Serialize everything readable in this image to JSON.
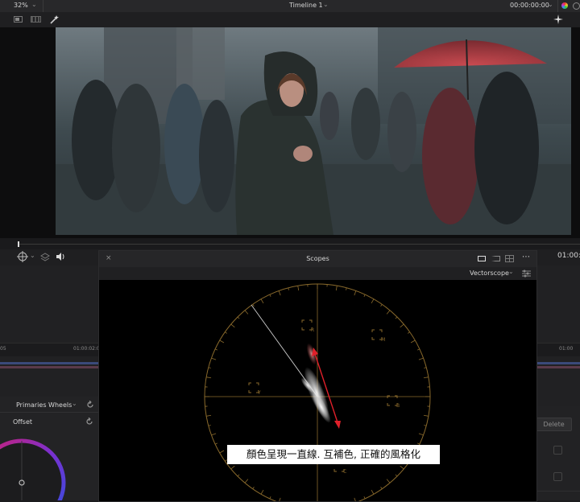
{
  "topbar": {
    "zoom": "32%",
    "timeline_title": "Timeline 1",
    "timecode": "00:00:00:00"
  },
  "viewer": {
    "timecode_right": "01:00:"
  },
  "timeline": {
    "ruler_left": "05",
    "ruler_mid": "01:00:02:0",
    "ruler_right": "01:00"
  },
  "scopes": {
    "title": "Scopes",
    "close_label": "×",
    "mode": "Vectorscope",
    "target_labels": [
      "R",
      "M",
      "B",
      "C",
      "G",
      "Y"
    ],
    "caption": "顏色呈現一直線. 互補色, 正確的風格化",
    "colors": {
      "graticule": "#8a6a2c",
      "arrow": "#e0202a"
    }
  },
  "color_panel": {
    "mode_label": "Primaries Wheels",
    "offset_label": "Offset"
  },
  "right_panel": {
    "delete_label": "Delete"
  },
  "icons": [
    "chevron-down-icon",
    "color-dot-icon",
    "settings-icon",
    "magic-wand-icon",
    "sparkle-icon",
    "target-icon",
    "layers-icon",
    "speaker-icon",
    "single-view-icon",
    "dual-view-icon",
    "grid-view-icon",
    "more-icon",
    "reset-icon",
    "scope-settings-icon"
  ]
}
